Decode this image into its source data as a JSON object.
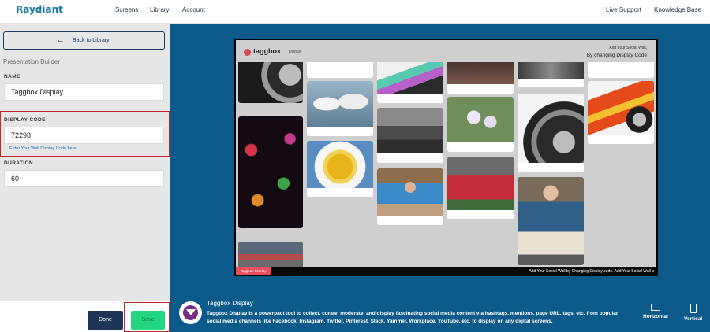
{
  "nav": {
    "brand": "Raydiant",
    "links": [
      "Screens",
      "Library",
      "Account"
    ],
    "right_links": [
      "Live Support",
      "Knowledge Base"
    ]
  },
  "builder": {
    "back_label": "Back to Library",
    "title": "Presentation Builder",
    "name_label": "NAME",
    "name_value": "Taggbox Display",
    "code_label": "DISPLAY CODE",
    "code_value": "72298",
    "code_hint": "Enter Your Wall Display Code here",
    "duration_label": "DURATION",
    "duration_value": "60",
    "done_label": "Done",
    "save_label": "Save"
  },
  "preview": {
    "logo": "taggbox",
    "logo_sub": "Display",
    "header_line1": "Add Your Social Wall,",
    "header_line2": "By changing Display Code",
    "ticker_badge": "Taggbox Display",
    "ticker_text": "Add Your Social Wall by Changing Display code. Add Your Social Wall b"
  },
  "app": {
    "name": "Taggbox Display",
    "description": "Taggbox Display is a powerpact tool to collect, curate, moderate, and display fascinating social media content via hashtags, mentions, page URL, tags, etc. from popular social media channels like Facebook, Instagram, Twitter, Pinterest, Slack, Yammer, Workplace, YouTube, etc. to display on any digital screens.",
    "orientations": [
      "Horizontal",
      "Vertical"
    ]
  },
  "colors": {
    "brand": "#1577a5",
    "canvas": "#0c5a8a",
    "done": "#1d3557",
    "save": "#24d67f",
    "highlight": "#c0282f",
    "ticker_badge": "#e94e5f"
  }
}
